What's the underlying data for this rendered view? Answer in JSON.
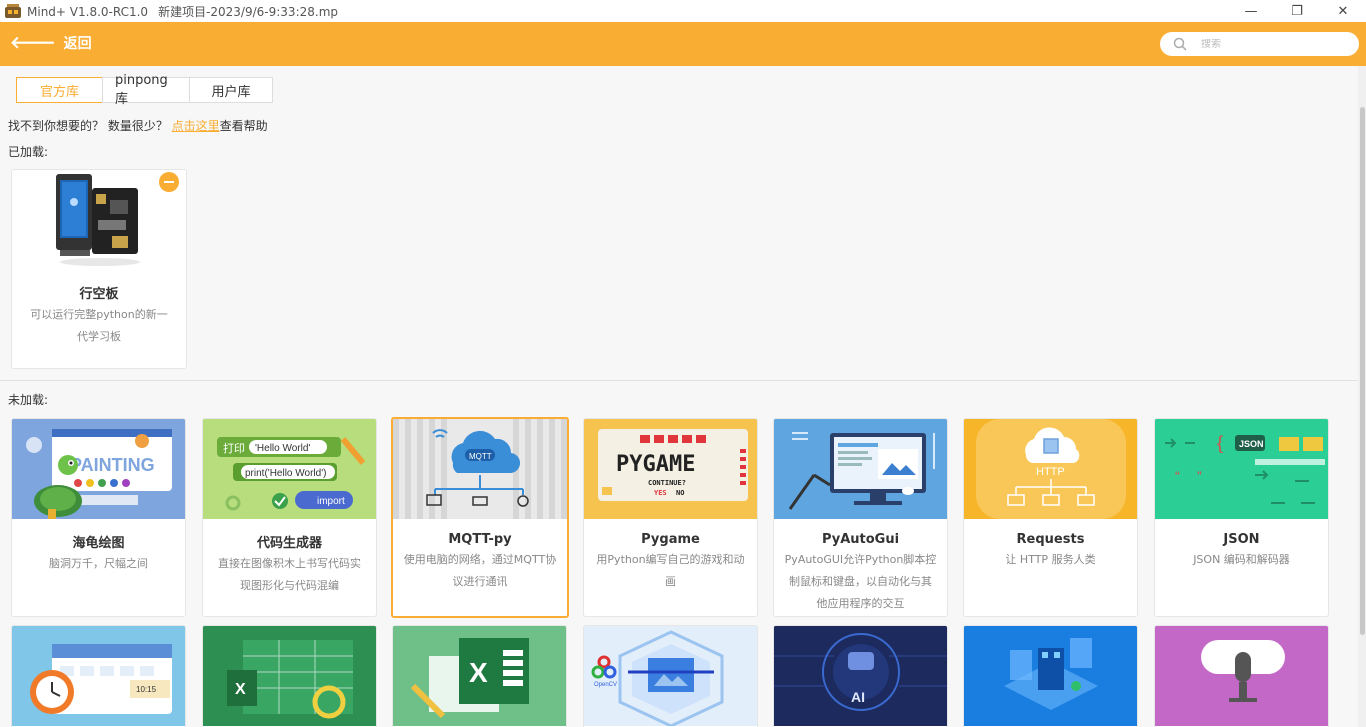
{
  "window": {
    "app_title": "Mind+ V1.8.0-RC1.0",
    "project": "新建项目-2023/9/6-9:33:28.mp",
    "minimize": "—",
    "maximize": "❐",
    "close": "✕"
  },
  "header": {
    "back_label": "返回",
    "search_placeholder": "搜索",
    "color": "#f9ad32"
  },
  "tabs": [
    {
      "label": "官方库",
      "active": true
    },
    {
      "label": "pinpong库",
      "active": false
    },
    {
      "label": "用户库",
      "active": false
    }
  ],
  "help": {
    "prefix": "找不到你想要的？ 数量很少？ ",
    "link": "点击这里",
    "suffix": "查看帮助"
  },
  "loaded": {
    "label": "已加载:",
    "items": [
      {
        "name": "行空板",
        "desc": "可以运行完整python的新一代学习板"
      }
    ]
  },
  "unloaded": {
    "label": "未加载:",
    "items": [
      {
        "name": "海龟绘图",
        "desc": "脑洞万千，尺幅之间"
      },
      {
        "name": "代码生成器",
        "desc": "直接在图像积木上书写代码实现图形化与代码混编"
      },
      {
        "name": "MQTT-py",
        "desc": "使用电脑的网络，通过MQTT协议进行通讯"
      },
      {
        "name": "Pygame",
        "desc": "用Python编写自己的游戏和动画"
      },
      {
        "name": "PyAutoGui",
        "desc": "PyAutoGUI允许Python脚本控制鼠标和键盘，以自动化与其他应用程序的交互"
      },
      {
        "name": "Requests",
        "desc": "让 HTTP 服务人类"
      },
      {
        "name": "JSON",
        "desc": "JSON 编码和解码器"
      }
    ]
  },
  "thumb_text": {
    "painting": "PAINTING",
    "print_label": "打印",
    "hello1": "'Hello World'",
    "hello2": "print('Hello World')",
    "import": "import",
    "mqtt": "MQTT",
    "pygame": "PYGAME",
    "continue": "CONTINUE?",
    "yes": "YES",
    "no": "NO",
    "http": "HTTP",
    "json": "JSON",
    "opencv": "OpenCV",
    "ai": "AI",
    "time": "10:15"
  }
}
